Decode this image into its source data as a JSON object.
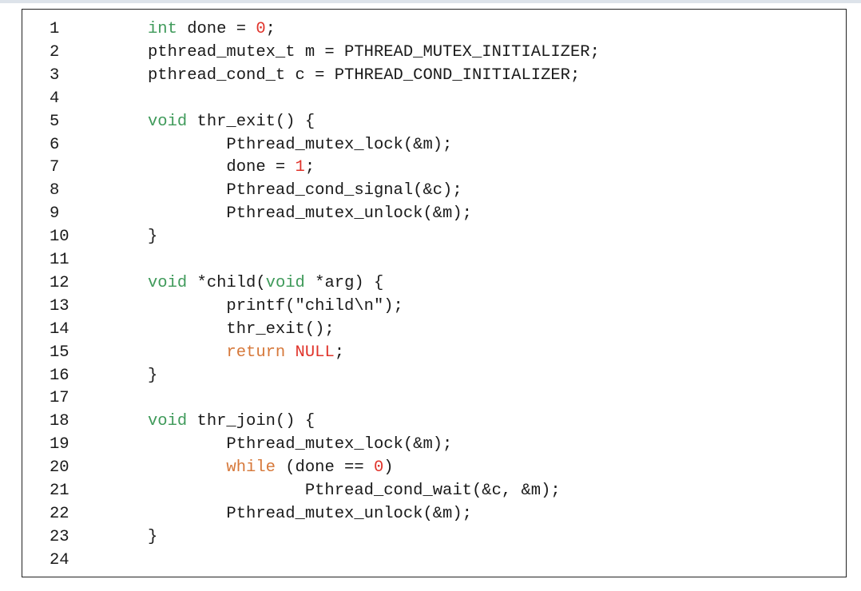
{
  "code_lines": [
    {
      "number": "1",
      "segments": [
        {
          "t": "int",
          "c": "kw-green"
        },
        {
          "t": " done = "
        },
        {
          "t": "0",
          "c": "lit-red"
        },
        {
          "t": ";"
        }
      ]
    },
    {
      "number": "2",
      "segments": [
        {
          "t": "pthread_mutex_t m = PTHREAD_MUTEX_INITIALIZER;"
        }
      ]
    },
    {
      "number": "3",
      "segments": [
        {
          "t": "pthread_cond_t c = PTHREAD_COND_INITIALIZER;"
        }
      ]
    },
    {
      "number": "4",
      "segments": []
    },
    {
      "number": "5",
      "segments": [
        {
          "t": "void",
          "c": "kw-green"
        },
        {
          "t": " thr_exit() {"
        }
      ]
    },
    {
      "number": "6",
      "segments": [
        {
          "t": "        Pthread_mutex_lock(&m);"
        }
      ]
    },
    {
      "number": "7",
      "segments": [
        {
          "t": "        done = "
        },
        {
          "t": "1",
          "c": "lit-red"
        },
        {
          "t": ";"
        }
      ]
    },
    {
      "number": "8",
      "segments": [
        {
          "t": "        Pthread_cond_signal(&c);"
        }
      ]
    },
    {
      "number": "9",
      "segments": [
        {
          "t": "        Pthread_mutex_unlock(&m);"
        }
      ]
    },
    {
      "number": "10",
      "segments": [
        {
          "t": "}"
        }
      ]
    },
    {
      "number": "11",
      "segments": []
    },
    {
      "number": "12",
      "segments": [
        {
          "t": "void",
          "c": "kw-green"
        },
        {
          "t": " *child("
        },
        {
          "t": "void",
          "c": "kw-green"
        },
        {
          "t": " *arg) {"
        }
      ]
    },
    {
      "number": "13",
      "segments": [
        {
          "t": "        printf(\"child\\n\");"
        }
      ]
    },
    {
      "number": "14",
      "segments": [
        {
          "t": "        thr_exit();"
        }
      ]
    },
    {
      "number": "15",
      "segments": [
        {
          "t": "        "
        },
        {
          "t": "return",
          "c": "kw-orange"
        },
        {
          "t": " "
        },
        {
          "t": "NULL",
          "c": "lit-red"
        },
        {
          "t": ";"
        }
      ]
    },
    {
      "number": "16",
      "segments": [
        {
          "t": "}"
        }
      ]
    },
    {
      "number": "17",
      "segments": []
    },
    {
      "number": "18",
      "segments": [
        {
          "t": "void",
          "c": "kw-green"
        },
        {
          "t": " thr_join() {"
        }
      ]
    },
    {
      "number": "19",
      "segments": [
        {
          "t": "        Pthread_mutex_lock(&m);"
        }
      ]
    },
    {
      "number": "20",
      "segments": [
        {
          "t": "        "
        },
        {
          "t": "while",
          "c": "kw-orange"
        },
        {
          "t": " (done == "
        },
        {
          "t": "0",
          "c": "lit-red"
        },
        {
          "t": ")"
        }
      ]
    },
    {
      "number": "21",
      "segments": [
        {
          "t": "                Pthread_cond_wait(&c, &m);"
        }
      ]
    },
    {
      "number": "22",
      "segments": [
        {
          "t": "        Pthread_mutex_unlock(&m);"
        }
      ]
    },
    {
      "number": "23",
      "segments": [
        {
          "t": "}"
        }
      ]
    },
    {
      "number": "24",
      "segments": []
    }
  ],
  "colors": {
    "keyword_type": "#3f9a5a",
    "keyword_control": "#d6783a",
    "literal": "#e0342b",
    "text": "#1a1a1a",
    "border": "#222222"
  }
}
